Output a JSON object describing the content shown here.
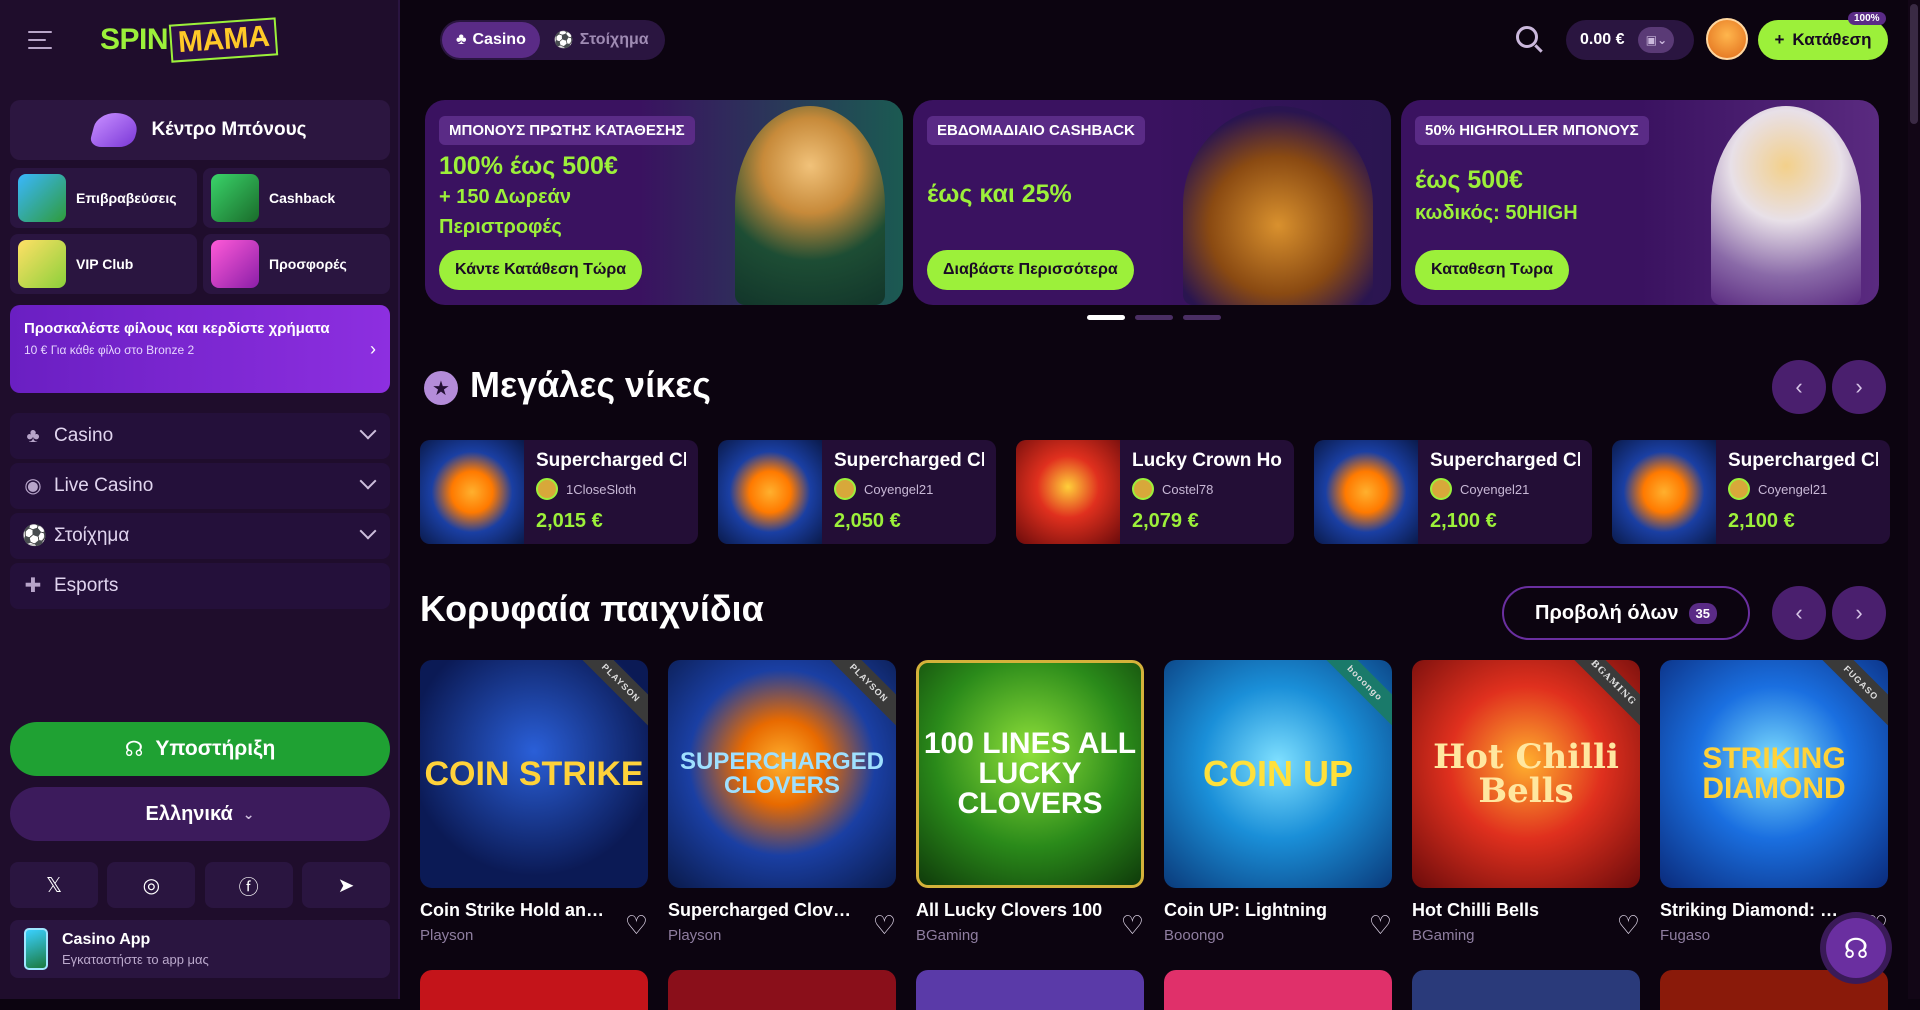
{
  "brand": {
    "logo_spin": "SPIN",
    "logo_mama": "MAMA"
  },
  "sidebar": {
    "bonus_center": "Κέντρο Μπόνους",
    "tiles": [
      {
        "label": "Επιβραβεύσεις",
        "icon": "rewards-icon"
      },
      {
        "label": "Cashback",
        "icon": "cashback-icon"
      },
      {
        "label": "VIP Club",
        "icon": "vip-key-icon"
      },
      {
        "label": "Προσφορές",
        "icon": "offers-icon"
      }
    ],
    "invite_title": "Προσκαλέστε φίλους και κερδίστε χρήματα",
    "invite_sub": "10 € Για κάθε φίλο στο Bronze 2",
    "nav": [
      {
        "label": "Casino"
      },
      {
        "label": "Live Casino"
      },
      {
        "label": "Στοίχημα"
      },
      {
        "label": "Esports"
      }
    ],
    "support": "Υποστήριξη",
    "language": "Ελληνικά",
    "app_title": "Casino App",
    "app_sub": "Εγκαταστήστε το app μας"
  },
  "header": {
    "tab_casino": "Casino",
    "tab_sport": "Στοίχημα",
    "balance": "0.00 €",
    "deposit": "Κατάθεση",
    "badge": "100%"
  },
  "banners": [
    {
      "tag": "ΜΠΟΝΟΥΣ ΠΡΩΤΗΣ ΚΑΤΑΘΕΣΗΣ",
      "line1": "100% έως 500€",
      "line2": "+ 150 Δωρεάν",
      "line3": "Περιστροφές",
      "button": "Κάντε Κατάθεση Τώρα"
    },
    {
      "tag": "ΕΒΔΟΜΑΔΙΑΙΟ CASHBACK",
      "line1": "έως και 25%",
      "button": "Διαβάστε Περισσότερα"
    },
    {
      "tag": "50% HIGHROLLER ΜΠΟΝΟΥΣ",
      "line1": "έως 500€",
      "line2": "κωδικός: 50HIGH",
      "button": "Καταθεση Τωρα"
    }
  ],
  "big_wins": {
    "title": "Μεγάλες νίκες",
    "items": [
      {
        "game": "Supercharged Clovers",
        "user": "1CloseSloth",
        "amount": "2,015 €"
      },
      {
        "game": "Supercharged Clovers",
        "user": "Coyengel21",
        "amount": "2,050 €"
      },
      {
        "game": "Lucky Crown Hold and Win",
        "user": "Costel78",
        "amount": "2,079 €"
      },
      {
        "game": "Supercharged Clovers",
        "user": "Coyengel21",
        "amount": "2,100 €"
      },
      {
        "game": "Supercharged Clovers",
        "user": "Coyengel21",
        "amount": "2,100 €"
      }
    ]
  },
  "top_games": {
    "title": "Κορυφαία παιχνίδια",
    "view_all": "Προβολή όλων",
    "count": "35",
    "items": [
      {
        "title": "Coin Strike Hold and Win",
        "provider": "Playson",
        "art": "COIN STRIKE",
        "corner": "PLAYSON"
      },
      {
        "title": "Supercharged Clovers",
        "provider": "Playson",
        "art": "SUPERCHARGED CLOVERS",
        "corner": "PLAYSON"
      },
      {
        "title": "All Lucky Clovers 100",
        "provider": "BGaming",
        "art": "100 LINES ALL LUCKY CLOVERS",
        "corner": ""
      },
      {
        "title": "Coin UP: Lightning",
        "provider": "Booongo",
        "art": "COIN UP",
        "corner": "booongo"
      },
      {
        "title": "Hot Chilli Bells",
        "provider": "BGaming",
        "art": "Hot Chilli Bells",
        "corner": "BGAMING"
      },
      {
        "title": "Striking Diamond: Running Wins",
        "provider": "Fugaso",
        "art": "STRIKING DIAMOND",
        "corner": "FUGASO"
      }
    ]
  },
  "colors": {
    "accent": "#9cf03a",
    "purple": "#5a2b86",
    "bg": "#0c0410",
    "support": "#1fa133"
  }
}
